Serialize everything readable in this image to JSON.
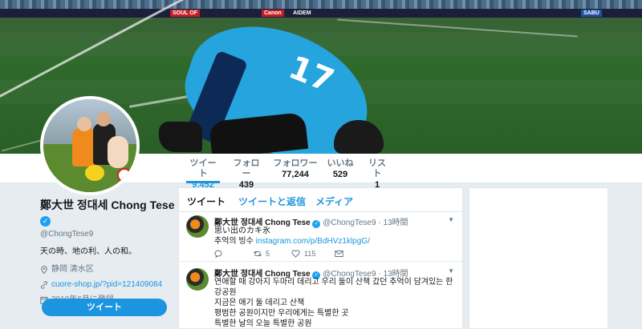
{
  "banner": {
    "ads": [
      "SOUL OF",
      "Canon",
      "AIDEM",
      "SABU"
    ]
  },
  "player": {
    "number": "17"
  },
  "nav": {
    "items": [
      {
        "label": "ツイート",
        "value": "9,452",
        "active": true
      },
      {
        "label": "フォロー",
        "value": "439",
        "active": false
      },
      {
        "label": "フォロワー",
        "value": "77,244",
        "active": false
      },
      {
        "label": "いいね",
        "value": "529",
        "active": false
      },
      {
        "label": "リスト",
        "value": "1",
        "active": false
      }
    ]
  },
  "profile": {
    "name": "鄭大世 정대세 Chong Tese",
    "handle": "@ChongTese9",
    "bio": "天の時、地の利、人の和。",
    "location": "静岡 清水区",
    "link": "cuore-shop.jp/?pid=121409084",
    "joined": "2010年6月に登録",
    "tweet_button": "ツイート"
  },
  "timeline": {
    "tabs": [
      "ツイート",
      "ツイートと返信",
      "メディア"
    ],
    "tweets": [
      {
        "name": "鄭大世 정대세 Chong Tese",
        "handle": "@ChongTese9",
        "time": "13時間",
        "lines": [
          "思い出のカキ氷",
          "추억의 빙수 "
        ],
        "link": "instagram.com/p/BdHVz1klpgG/",
        "retweets": "5",
        "likes": "115"
      },
      {
        "name": "鄭大世 정대세 Chong Tese",
        "handle": "@ChongTese9",
        "time": "13時間",
        "lines": [
          "연애할 때 강아지 두마리 데리고 우리 둘이 산책 갔던 추억이 담겨있는 한",
          "강공원",
          "지금은 애기 둘 데리고 산책",
          "평범한 공원이지만 우리에게는 특별한 곳",
          "특별한 날의 오늘 특별한 공원"
        ]
      }
    ]
  },
  "colors": {
    "accent": "#1b95e0",
    "background": "#e6ecf0",
    "text": "#14171a",
    "muted": "#657786"
  }
}
